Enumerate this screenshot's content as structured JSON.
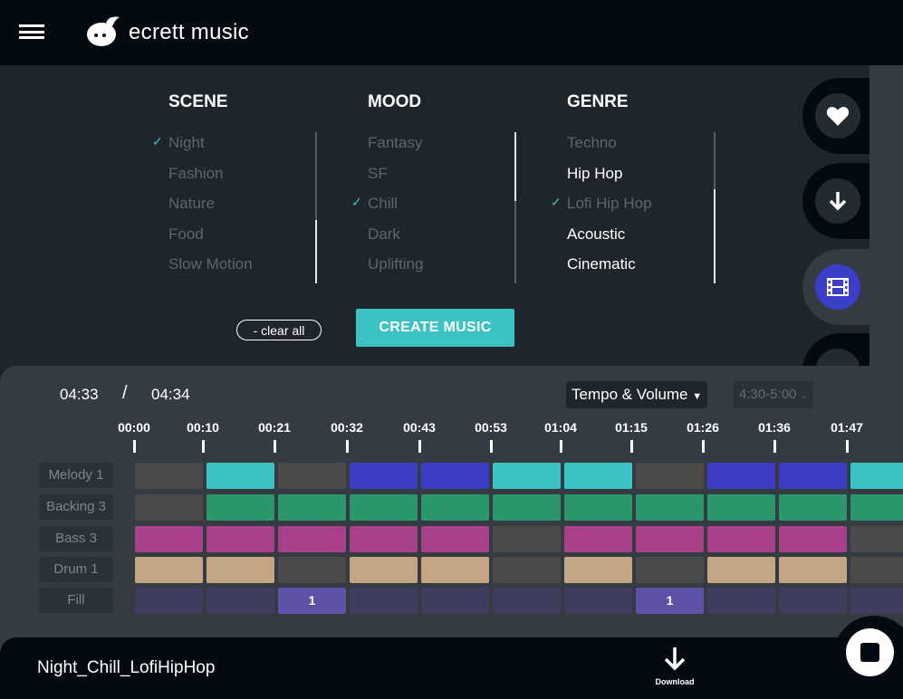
{
  "header": {
    "brand": "ecrett music"
  },
  "sidebar_icons": [
    "heart-icon",
    "download-icon",
    "film-icon",
    "refresh-icon"
  ],
  "scene": {
    "title": "SCENE",
    "options": [
      {
        "label": "Night",
        "state": "selected"
      },
      {
        "label": "Fashion",
        "state": "dim"
      },
      {
        "label": "Nature",
        "state": "dim"
      },
      {
        "label": "Food",
        "state": "dim"
      },
      {
        "label": "Slow Motion",
        "state": "dim"
      }
    ]
  },
  "mood": {
    "title": "MOOD",
    "options": [
      {
        "label": "Fantasy",
        "state": "dim"
      },
      {
        "label": "SF",
        "state": "dim"
      },
      {
        "label": "Chill",
        "state": "selected"
      },
      {
        "label": "Dark",
        "state": "dim"
      },
      {
        "label": "Uplifting",
        "state": "dim"
      }
    ]
  },
  "genre": {
    "title": "GENRE",
    "options": [
      {
        "label": "Techno",
        "state": "dim"
      },
      {
        "label": "Hip Hop",
        "state": "white"
      },
      {
        "label": "Lofi Hip Hop",
        "state": "selected"
      },
      {
        "label": "Acoustic",
        "state": "white"
      },
      {
        "label": "Cinematic",
        "state": "white"
      }
    ]
  },
  "actions": {
    "clear_all": "- clear all",
    "create": "CREATE MUSIC"
  },
  "player": {
    "current": "04:33",
    "separator": "/",
    "total": "04:34",
    "mode_select": "Tempo & Volume",
    "range_select": "4:30-5:00"
  },
  "timeline": [
    "00:00",
    "00:10",
    "00:21",
    "00:32",
    "00:43",
    "00:53",
    "01:04",
    "01:15",
    "01:26",
    "01:36",
    "01:47"
  ],
  "colors": {
    "off": "#4a4a4a",
    "cyan": "#3bc2c4",
    "blue": "#3d3dc4",
    "green": "#2a976a",
    "pink": "#a8408a",
    "tan": "#c4a584",
    "fill_off": "#3e3d5e",
    "fill_on": "#5e52a8",
    "accent": "#3bc2c4"
  },
  "tracks": [
    {
      "label": "Melody 1",
      "cells": [
        "off",
        "cyan",
        "off",
        "blue",
        "blue",
        "cyan",
        "cyan",
        "off",
        "blue",
        "blue",
        "cyan"
      ]
    },
    {
      "label": "Backing 3",
      "cells": [
        "off",
        "green",
        "green",
        "green",
        "green",
        "green",
        "green",
        "green",
        "green",
        "green",
        "green"
      ]
    },
    {
      "label": "Bass 3",
      "cells": [
        "pink",
        "pink",
        "pink",
        "pink",
        "pink",
        "off",
        "pink",
        "pink",
        "pink",
        "pink",
        "off"
      ]
    },
    {
      "label": "Drum 1",
      "cells": [
        "tan",
        "tan",
        "off",
        "tan",
        "tan",
        "off",
        "tan",
        "off",
        "tan",
        "tan",
        "off"
      ]
    },
    {
      "label": "Fill",
      "cells": [
        "fill_off",
        "fill_off",
        "fill_on",
        "fill_off",
        "fill_off",
        "fill_off",
        "fill_off",
        "fill_on",
        "fill_off",
        "fill_off",
        "fill_off"
      ],
      "texts": [
        "",
        "",
        "1",
        "",
        "",
        "",
        "",
        "1",
        "",
        "",
        ""
      ]
    }
  ],
  "footer": {
    "track_name": "Night_Chill_LofiHipHop",
    "download": "Download"
  }
}
